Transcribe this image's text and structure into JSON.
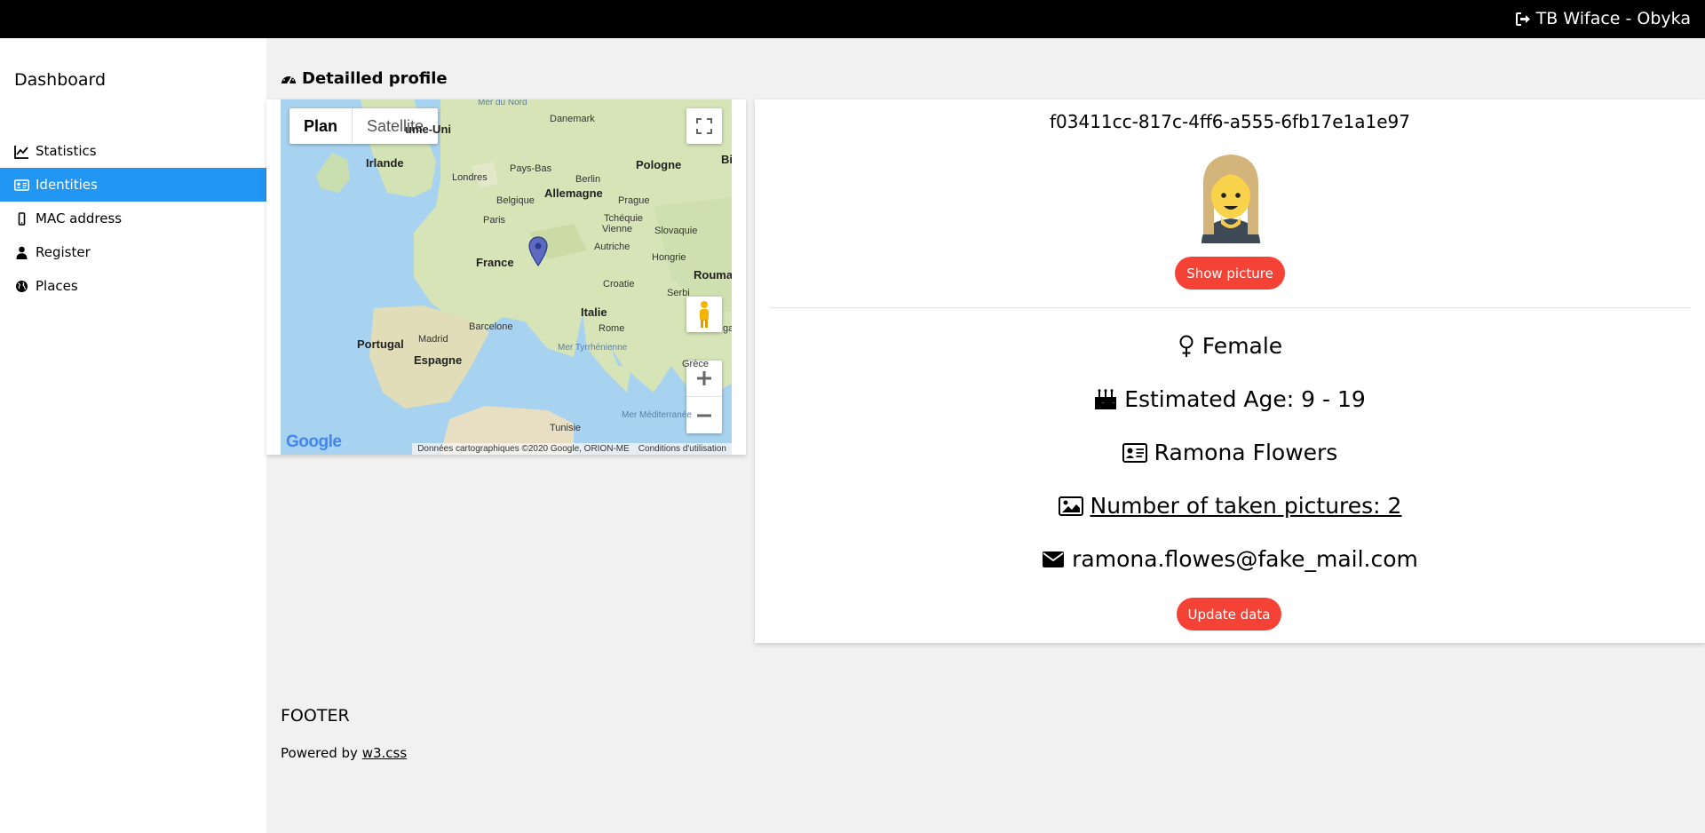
{
  "topbar": {
    "title": "TB Wiface - Obyka",
    "icon": "sign-out-icon"
  },
  "sidebar": {
    "title": "Dashboard",
    "items": [
      {
        "label": "Statistics",
        "icon": "line-chart-icon",
        "active": false
      },
      {
        "label": "Identities",
        "icon": "id-card-icon",
        "active": true
      },
      {
        "label": "MAC address",
        "icon": "mobile-icon",
        "active": false
      },
      {
        "label": "Register",
        "icon": "user-icon",
        "active": false
      },
      {
        "label": "Places",
        "icon": "globe-icon",
        "active": false
      }
    ]
  },
  "page": {
    "title": "Detailled profile",
    "icon": "tachometer-icon"
  },
  "map": {
    "type_buttons": [
      "Plan",
      "Satellite"
    ],
    "labels": {
      "mer_du_nord": "Mer du Nord",
      "danemark": "Danemark",
      "royaume_uni": "ume-Uni",
      "irlande": "Irlande",
      "londres": "Londres",
      "pays_bas": "Pays-Bas",
      "berlin": "Berlin",
      "pologne": "Pologne",
      "allemagne": "Allemagne",
      "belgique": "Belgique",
      "prague": "Prague",
      "paris": "Paris",
      "tcheque": "Tchéquie",
      "vienne": "Vienne",
      "slovaquie": "Slovaquie",
      "autriche": "Autriche",
      "hongrie": "Hongrie",
      "france": "France",
      "roumanie": "Rouma",
      "croatie": "Croatie",
      "serbie": "Serbi",
      "italie": "Italie",
      "madrid": "Madrid",
      "barcelone": "Barcelone",
      "rome": "Rome",
      "portugal": "Portugal",
      "espagne": "Espagne",
      "mer_tyrrhenienne": "Mer Tyrrhénienne",
      "tunisie": "Tunisie",
      "mer_mediterranee": "Mer Méditerranée",
      "bi": "Bi",
      "grece": "Grèce",
      "ga": "ga"
    },
    "attribution": "Données cartographiques ©2020 Google, ORION-ME",
    "terms": "Conditions d'utilisation",
    "logo": "Google"
  },
  "profile": {
    "uuid": "f03411cc-817c-4ff6-a555-6fb17e1a1e97",
    "show_picture": "Show picture",
    "gender": "Female",
    "age": "Estimated Age: 9 - 19",
    "name": "Ramona Flowers",
    "pictures": "Number of taken pictures: 2",
    "email": "ramona.flowes@fake_mail.com",
    "update": "Update data"
  },
  "footer": {
    "title": "FOOTER",
    "powered": "Powered by ",
    "link": "w3.css"
  },
  "colors": {
    "accent": "#2196f3",
    "button": "#f44336",
    "topbar": "#000000"
  }
}
